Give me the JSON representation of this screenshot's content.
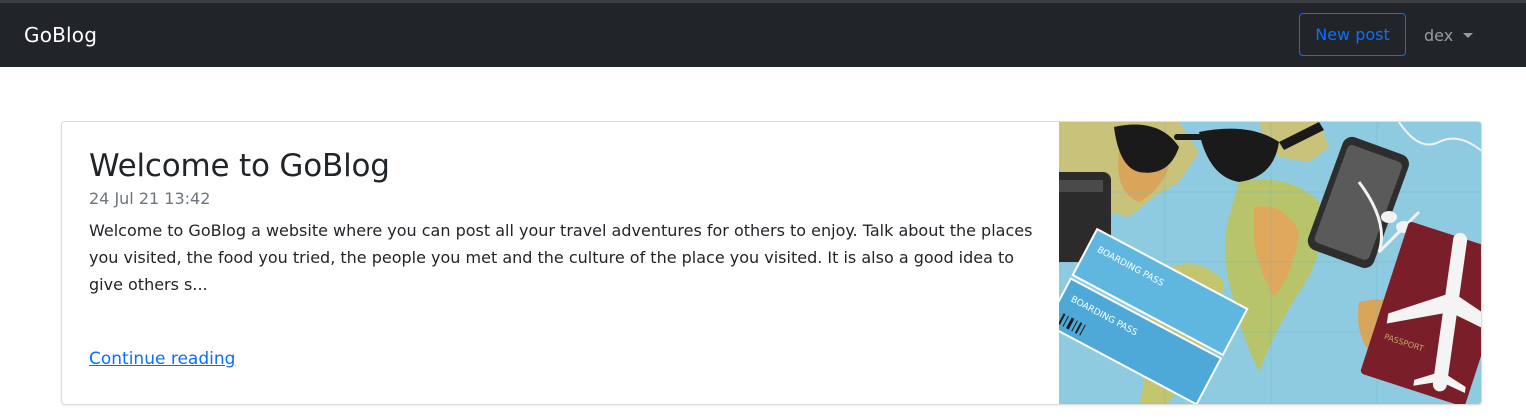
{
  "navbar": {
    "brand": "GoBlog",
    "new_post_label": "New post",
    "username": "dex"
  },
  "post": {
    "title": "Welcome to GoBlog",
    "date": "24 Jul 21 13:42",
    "excerpt": "Welcome to GoBlog a website where you can post all your travel adventures for others to enjoy. Talk about the places you visited, the food you tried, the people you met and the culture of the place you visited. It is also a good idea to give others s...",
    "continue_label": "Continue reading",
    "image": {
      "description_icon": "travel-map-photo",
      "pass_text_1": "BOARDING PASS",
      "pass_text_2": "BOARDING PASS",
      "passport_text": "PASSPORT"
    }
  },
  "colors": {
    "navbar_bg": "#212529",
    "accent": "#0d6efd",
    "muted": "#6c757d"
  }
}
